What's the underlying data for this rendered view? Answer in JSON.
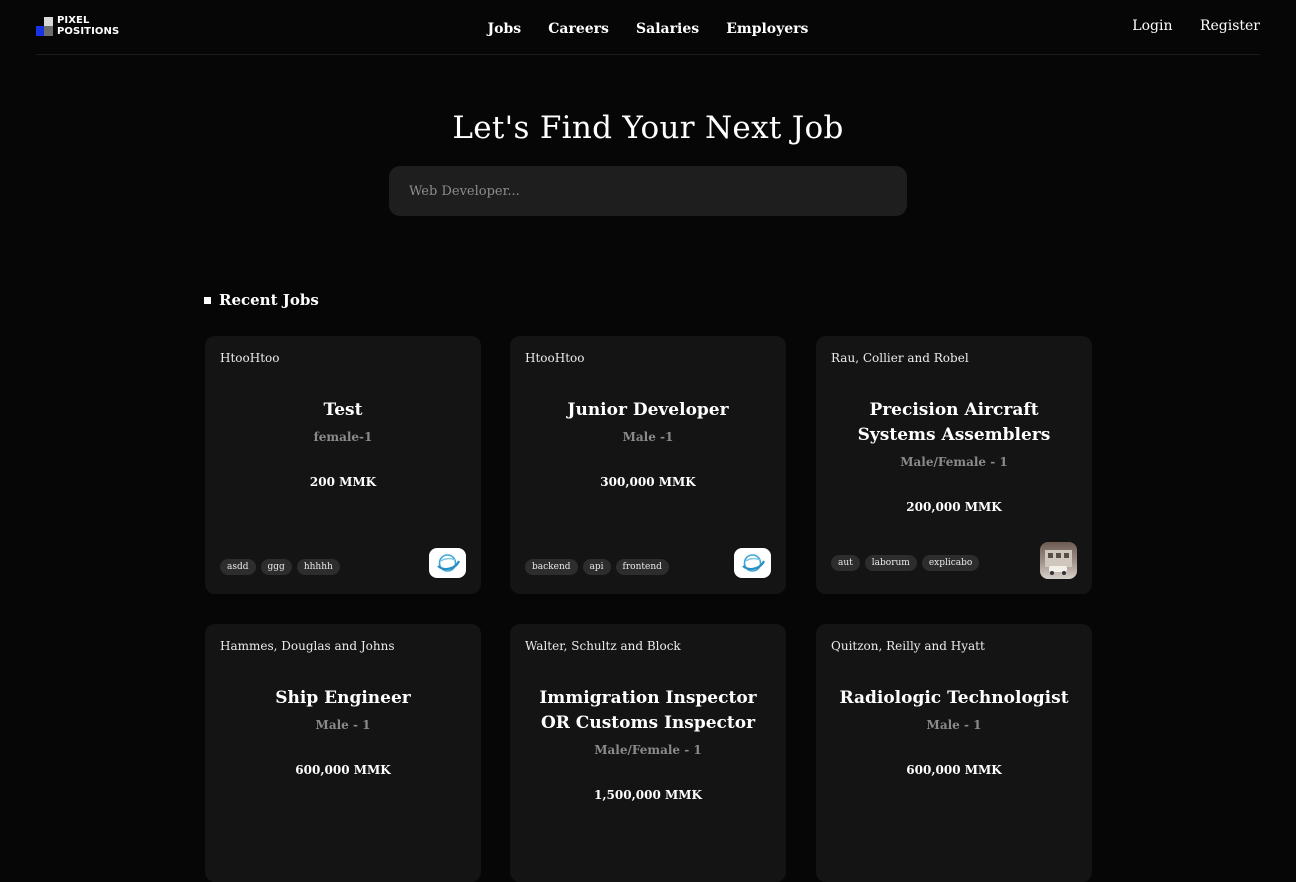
{
  "brand": {
    "line1": "PIXEL",
    "line2": "POSITIONS"
  },
  "nav": {
    "links": [
      "Jobs",
      "Careers",
      "Salaries",
      "Employers"
    ],
    "login": "Login",
    "register": "Register"
  },
  "hero": {
    "title": "Let's Find Your Next Job",
    "search_placeholder": "Web Developer..."
  },
  "recent": {
    "heading": "Recent Jobs",
    "jobs": [
      {
        "employer": "HtooHtoo",
        "title": "Test",
        "sub": "female-1",
        "salary": "200 MMK",
        "tags": [
          "asdd",
          "ggg",
          "hhhhh"
        ],
        "logo": "blue-swirl-logo"
      },
      {
        "employer": "HtooHtoo",
        "title": "Junior Developer",
        "sub": "Male -1",
        "salary": "300,000 MMK",
        "tags": [
          "backend",
          "api",
          "frontend"
        ],
        "logo": "blue-swirl-logo"
      },
      {
        "employer": "Rau, Collier and Robel",
        "title": "Precision Aircraft Systems Assemblers",
        "sub": "Male/Female - 1",
        "salary": "200,000 MMK",
        "tags": [
          "aut",
          "laborum",
          "explicabo"
        ],
        "logo": "building-photo"
      },
      {
        "employer": "Hammes, Douglas and Johns",
        "title": "Ship Engineer",
        "sub": "Male - 1",
        "salary": "600,000 MMK",
        "tags": [],
        "logo": ""
      },
      {
        "employer": "Walter, Schultz and Block",
        "title": "Immigration Inspector OR Customs Inspector",
        "sub": "Male/Female - 1",
        "salary": "1,500,000 MMK",
        "tags": [],
        "logo": ""
      },
      {
        "employer": "Quitzon, Reilly and Hyatt",
        "title": "Radiologic Technologist",
        "sub": "Male - 1",
        "salary": "600,000 MMK",
        "tags": [],
        "logo": ""
      }
    ]
  },
  "colors": {
    "background": "#060606",
    "card": "#141414",
    "search": "#1e1e1e",
    "tag": "#2d2d2d",
    "logo_blue": "#1833e6"
  }
}
